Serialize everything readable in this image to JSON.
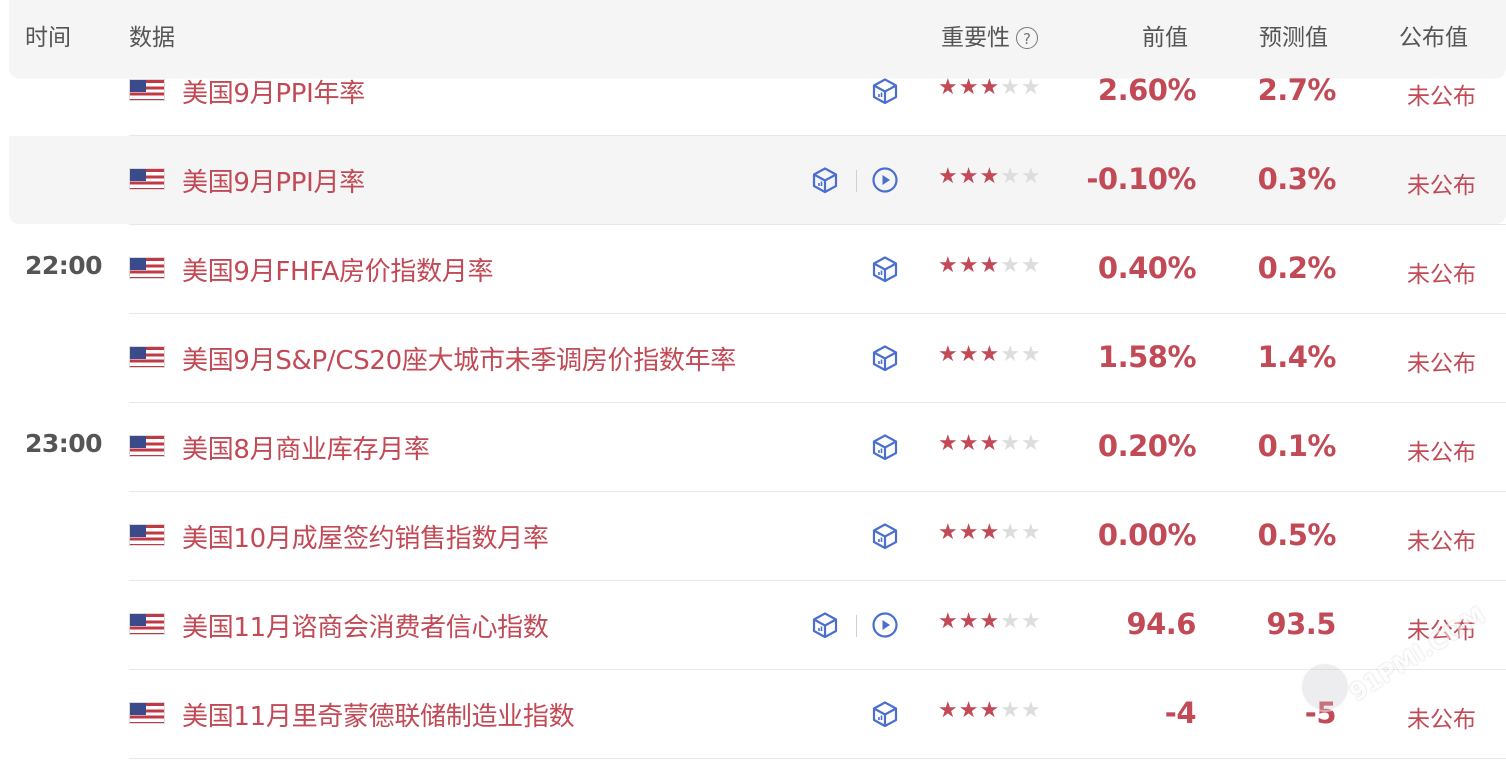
{
  "header": {
    "time": "时间",
    "data": "数据",
    "importance": "重要性",
    "previous": "前值",
    "forecast": "预测值",
    "actual": "公布值"
  },
  "rows": [
    {
      "time": "",
      "name": "美国9月PPI年率",
      "icons": [
        "data-cube-icon"
      ],
      "stars": 3,
      "previous": "2.60%",
      "forecast": "2.7%",
      "actual": "未公布"
    },
    {
      "time": "",
      "name": "美国9月PPI月率",
      "icons": [
        "data-cube-icon",
        "play-icon"
      ],
      "stars": 3,
      "previous": "-0.10%",
      "forecast": "0.3%",
      "actual": "未公布"
    },
    {
      "time": "22:00",
      "name": "美国9月FHFA房价指数月率",
      "icons": [
        "data-cube-icon"
      ],
      "stars": 3,
      "previous": "0.40%",
      "forecast": "0.2%",
      "actual": "未公布"
    },
    {
      "time": "",
      "name": "美国9月S&P/CS20座大城市未季调房价指数年率",
      "icons": [
        "data-cube-icon"
      ],
      "stars": 3,
      "previous": "1.58%",
      "forecast": "1.4%",
      "actual": "未公布"
    },
    {
      "time": "23:00",
      "name": "美国8月商业库存月率",
      "icons": [
        "data-cube-icon"
      ],
      "stars": 3,
      "previous": "0.20%",
      "forecast": "0.1%",
      "actual": "未公布"
    },
    {
      "time": "",
      "name": "美国10月成屋签约销售指数月率",
      "icons": [
        "data-cube-icon"
      ],
      "stars": 3,
      "previous": "0.00%",
      "forecast": "0.5%",
      "actual": "未公布"
    },
    {
      "time": "",
      "name": "美国11月谘商会消费者信心指数",
      "icons": [
        "data-cube-icon",
        "play-icon"
      ],
      "stars": 3,
      "previous": "94.6",
      "forecast": "93.5",
      "actual": "未公布"
    },
    {
      "time": "",
      "name": "美国11月里奇蒙德联储制造业指数",
      "icons": [
        "data-cube-icon"
      ],
      "stars": 3,
      "previous": "-4",
      "forecast": "-5",
      "actual": "未公布"
    }
  ],
  "watermark": "91PMI.COM",
  "colors": {
    "accent": "#c24a56",
    "icon": "#4a6fd0",
    "header_bg": "#f5f5f6"
  }
}
